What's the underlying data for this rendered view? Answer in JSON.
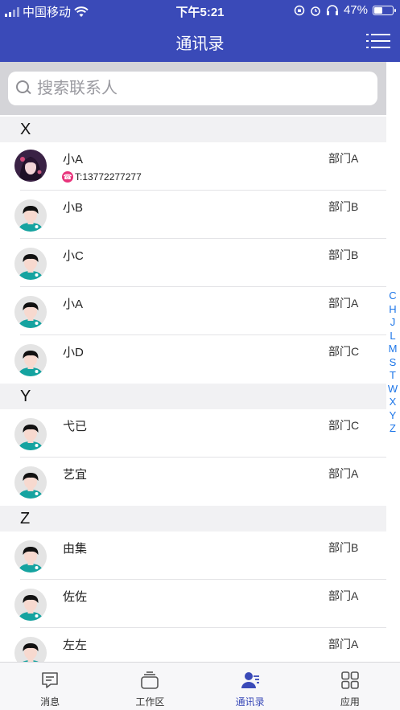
{
  "status_bar": {
    "carrier": "中国移动",
    "time": "下午5:21",
    "battery_text": "47%",
    "battery_level": 0.47
  },
  "nav": {
    "title": "通讯录",
    "menu_icon": "list-menu-icon"
  },
  "search": {
    "placeholder": "搜索联系人",
    "value": ""
  },
  "sections": [
    {
      "letter": "X",
      "contacts": [
        {
          "name": "小A",
          "dept": "部门A",
          "phone": "T:13772277277",
          "avatar": "photo"
        },
        {
          "name": "小B",
          "dept": "部门B",
          "avatar": "default"
        },
        {
          "name": "小C",
          "dept": "部门B",
          "avatar": "default"
        },
        {
          "name": "小A",
          "dept": "部门A",
          "avatar": "default"
        },
        {
          "name": "小D",
          "dept": "部门C",
          "avatar": "default"
        }
      ]
    },
    {
      "letter": "Y",
      "contacts": [
        {
          "name": "弋已",
          "dept": "部门C",
          "avatar": "default"
        },
        {
          "name": "艺宜",
          "dept": "部门A",
          "avatar": "default"
        }
      ]
    },
    {
      "letter": "Z",
      "contacts": [
        {
          "name": "由集",
          "dept": "部门B",
          "avatar": "default"
        },
        {
          "name": "佐佐",
          "dept": "部门A",
          "avatar": "default"
        },
        {
          "name": "左左",
          "dept": "部门A",
          "avatar": "default"
        }
      ]
    }
  ],
  "index_letters": [
    "C",
    "H",
    "J",
    "L",
    "M",
    "S",
    "T",
    "W",
    "X",
    "Y",
    "Z"
  ],
  "tabs": [
    {
      "label": "消息",
      "icon": "message-icon",
      "active": false
    },
    {
      "label": "工作区",
      "icon": "workspace-icon",
      "active": false
    },
    {
      "label": "通讯录",
      "icon": "contacts-icon",
      "active": true
    },
    {
      "label": "应用",
      "icon": "apps-grid-icon",
      "active": false
    }
  ],
  "colors": {
    "primary": "#3a4ab8",
    "index_letters": "#1d76e8",
    "phone_badge": "#e8337b",
    "avatar_teal": "#15a3a0"
  }
}
